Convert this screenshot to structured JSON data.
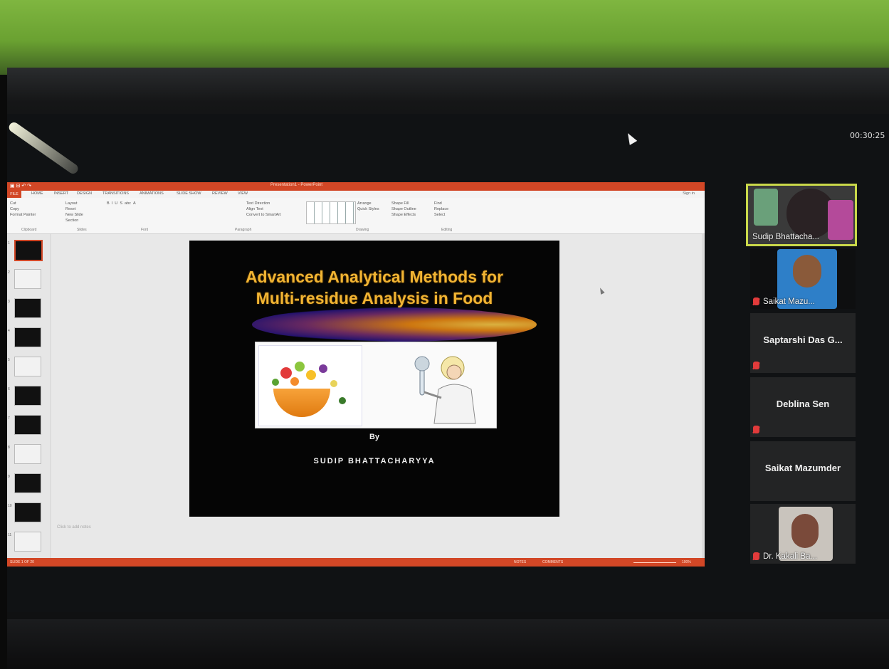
{
  "meeting": {
    "timer": "00:30:25"
  },
  "powerpoint": {
    "title_bar": "Presentation1 - PowerPoint",
    "tabs": [
      "FILE",
      "HOME",
      "INSERT",
      "DESIGN",
      "TRANSITIONS",
      "ANIMATIONS",
      "SLIDE SHOW",
      "REVIEW",
      "VIEW"
    ],
    "sign_in": "Sign in",
    "ribbon": {
      "clipboard": [
        "Cut",
        "Copy",
        "Format Painter",
        "Clipboard"
      ],
      "slides": [
        "Layout",
        "Reset",
        "New Slide",
        "Section",
        "Slides"
      ],
      "font_label": "Font",
      "paragraph": [
        "Text Direction",
        "Align Text",
        "Convert to SmartArt",
        "Paragraph"
      ],
      "drawing": [
        "Arrange",
        "Quick Styles",
        "Shape Fill",
        "Shape Outline",
        "Shape Effects",
        "Drawing"
      ],
      "editing": [
        "Find",
        "Replace",
        "Select",
        "Editing"
      ]
    },
    "notes_placeholder": "Click to add notes",
    "status": {
      "slide_of": "SLIDE 1 OF 20",
      "notes": "NOTES",
      "comments": "COMMENTS",
      "zoom": "100%"
    },
    "thumbnail_count": 11
  },
  "slide": {
    "title_line1": "Advanced Analytical Methods for",
    "title_line2": "Multi-residue Analysis in Food",
    "by": "By",
    "author": "SUDIP BHATTACHARYYA"
  },
  "participants": [
    {
      "name": "Sudip Bhattacha...",
      "video": true,
      "active": true,
      "muted": false
    },
    {
      "name": "Saikat Mazu...",
      "video": true,
      "active": false,
      "muted": true
    },
    {
      "name": "Saptarshi Das G...",
      "video": false,
      "active": false,
      "muted": true
    },
    {
      "name": "Deblina Sen",
      "video": false,
      "active": false,
      "muted": true
    },
    {
      "name": "Saikat Mazumder",
      "video": false,
      "active": false,
      "muted": false
    },
    {
      "name": "Dr. Kakali Ba...",
      "video": true,
      "active": false,
      "muted": true
    }
  ]
}
